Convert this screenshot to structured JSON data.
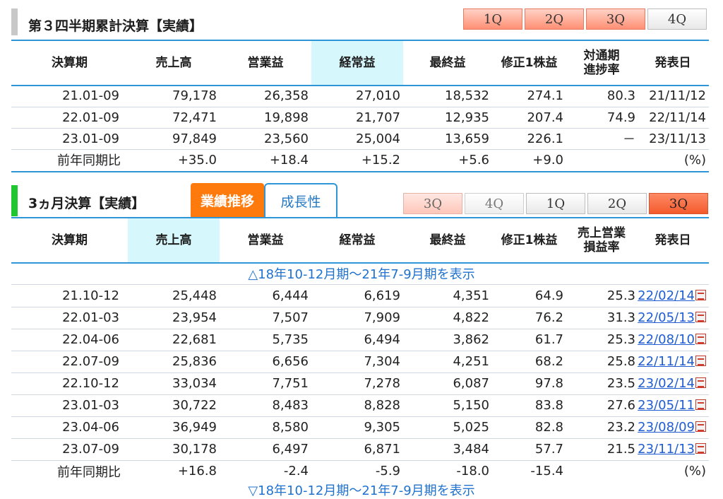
{
  "section1": {
    "title": "第３四半期累計決算【実績】",
    "tabs": [
      "1Q",
      "2Q",
      "3Q",
      "4Q"
    ],
    "headers": [
      "決算期",
      "売上高",
      "営業益",
      "経常益",
      "最終益",
      "修正1株益",
      "対通期|進捗率",
      "発表日"
    ],
    "rows": [
      [
        "21.01-09",
        "79,178",
        "26,358",
        "27,010",
        "18,532",
        "274.1",
        "80.3",
        "21/11/12"
      ],
      [
        "22.01-09",
        "72,471",
        "19,898",
        "21,707",
        "12,935",
        "207.4",
        "74.9",
        "22/11/14"
      ],
      [
        "23.01-09",
        "97,849",
        "23,560",
        "25,004",
        "13,659",
        "226.1",
        "－",
        "23/11/13"
      ]
    ],
    "yoy": [
      "前年同期比",
      "+35.0",
      "+18.4",
      "+15.2",
      "+5.6",
      "+9.0",
      "",
      "(%)"
    ]
  },
  "section2": {
    "title": "3ヵ月決算【実績】",
    "tab_trend": "業績推移",
    "tab_growth": "成長性",
    "tabs": [
      "3Q",
      "4Q",
      "1Q",
      "2Q",
      "3Q"
    ],
    "headers": [
      "決算期",
      "売上高",
      "営業益",
      "経常益",
      "最終益",
      "修正1株益",
      "売上営業|損益率",
      "発表日"
    ],
    "show_prev": "△18年10-12月期～21年7-9月期を表示",
    "rows": [
      [
        "21.10-12",
        "25,448",
        "6,444",
        "6,619",
        "4,351",
        "64.9",
        "25.3",
        "22/02/14"
      ],
      [
        "22.01-03",
        "23,954",
        "7,507",
        "7,909",
        "4,822",
        "76.2",
        "31.3",
        "22/05/13"
      ],
      [
        "22.04-06",
        "22,681",
        "5,735",
        "6,494",
        "3,862",
        "61.7",
        "25.3",
        "22/08/10"
      ],
      [
        "22.07-09",
        "25,836",
        "6,656",
        "7,304",
        "4,251",
        "68.2",
        "25.8",
        "22/11/14"
      ],
      [
        "22.10-12",
        "33,034",
        "7,751",
        "7,278",
        "6,087",
        "97.8",
        "23.5",
        "23/02/14"
      ],
      [
        "23.01-03",
        "30,722",
        "8,483",
        "8,828",
        "5,150",
        "83.8",
        "27.6",
        "23/05/11"
      ],
      [
        "23.04-06",
        "36,949",
        "8,580",
        "9,305",
        "5,025",
        "82.8",
        "23.2",
        "23/08/09"
      ],
      [
        "23.07-09",
        "30,178",
        "6,497",
        "6,871",
        "3,484",
        "57.7",
        "21.5",
        "23/11/13"
      ]
    ],
    "yoy": [
      "前年同期比",
      "+16.8",
      "-2.4",
      "-5.9",
      "-18.0",
      "-15.4",
      "",
      "(%)"
    ],
    "show_next": "▽18年10-12月期～21年7-9月期を表示"
  },
  "colors": {
    "accent_blue": "#2e95d6",
    "positive": "#ff1d0e",
    "negative": "#1a6fe8",
    "tab_orange": "#ff7a0d",
    "header_highlight": "#d6f7fb"
  },
  "icons": {
    "pdf": "pdf-icon"
  }
}
